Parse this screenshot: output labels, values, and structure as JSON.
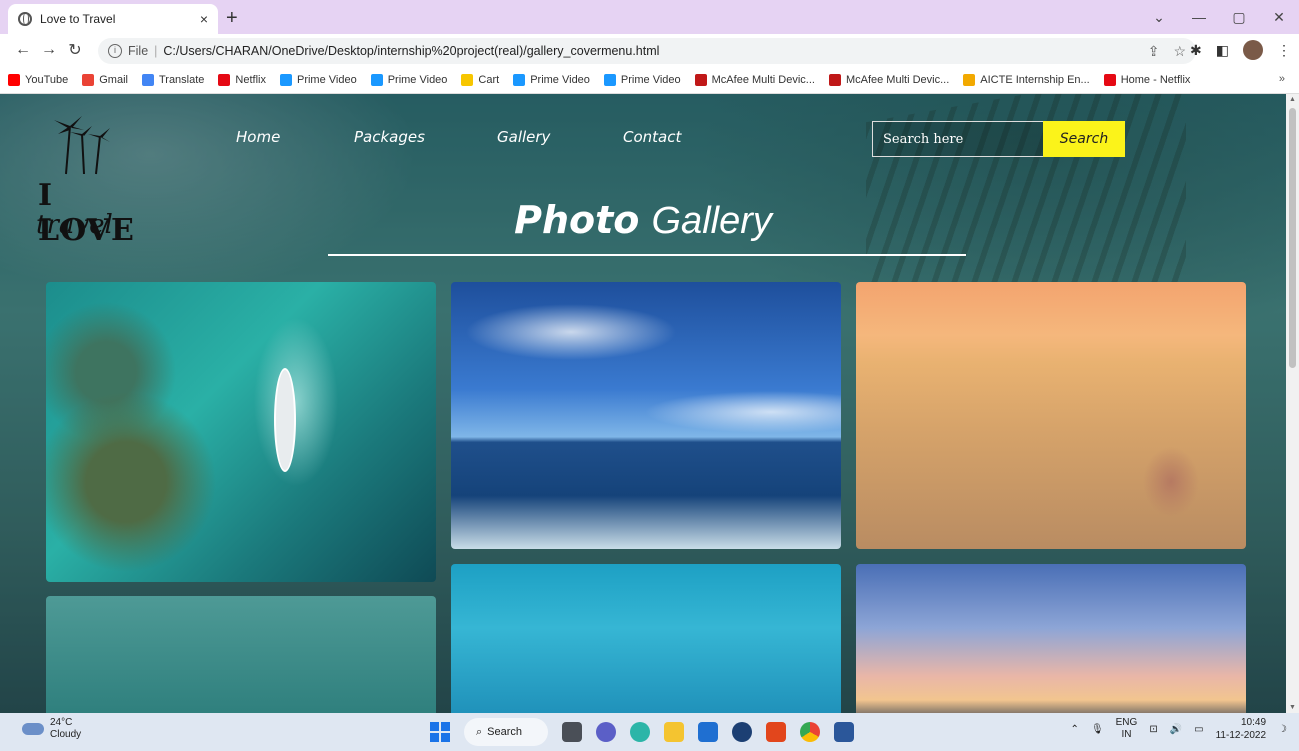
{
  "browser": {
    "tab_title": "Love to Travel",
    "tab_close": "×",
    "new_tab": "+",
    "url_prefix": "File",
    "url": "C:/Users/CHARAN/OneDrive/Desktop/internship%20project(real)/gallery_covermenu.html",
    "window_controls": [
      "⌄",
      "—",
      "▢",
      "✕"
    ],
    "bookmarks": [
      {
        "label": "YouTube",
        "color": "#ff0000"
      },
      {
        "label": "Gmail",
        "color": "#ea4335"
      },
      {
        "label": "Translate",
        "color": "#4285f4"
      },
      {
        "label": "Netflix",
        "color": "#e50914"
      },
      {
        "label": "Prime Video",
        "color": "#1a98ff"
      },
      {
        "label": "Prime Video",
        "color": "#1a98ff"
      },
      {
        "label": "Cart",
        "color": "#f7c600"
      },
      {
        "label": "Prime Video",
        "color": "#1a98ff"
      },
      {
        "label": "Prime Video",
        "color": "#1a98ff"
      },
      {
        "label": "McAfee Multi Devic...",
        "color": "#c01818"
      },
      {
        "label": "McAfee Multi Devic...",
        "color": "#c01818"
      },
      {
        "label": "AICTE Internship En...",
        "color": "#f2a900"
      },
      {
        "label": "Home - Netflix",
        "color": "#e50914"
      }
    ],
    "bookmarks_more": "»"
  },
  "site": {
    "logo_line1": "I LOVE",
    "logo_line2": "travel",
    "nav": [
      "Home",
      "Packages",
      "Gallery",
      "Contact"
    ],
    "search_placeholder": "Search here",
    "search_button": "Search",
    "heading_bold": "Photo",
    "heading_light": "Gallery"
  },
  "taskbar": {
    "temperature": "24°C",
    "weather": "Cloudy",
    "search_label": "Search",
    "lang_top": "ENG",
    "lang_bottom": "IN",
    "time": "10:49",
    "date": "11-12-2022"
  }
}
